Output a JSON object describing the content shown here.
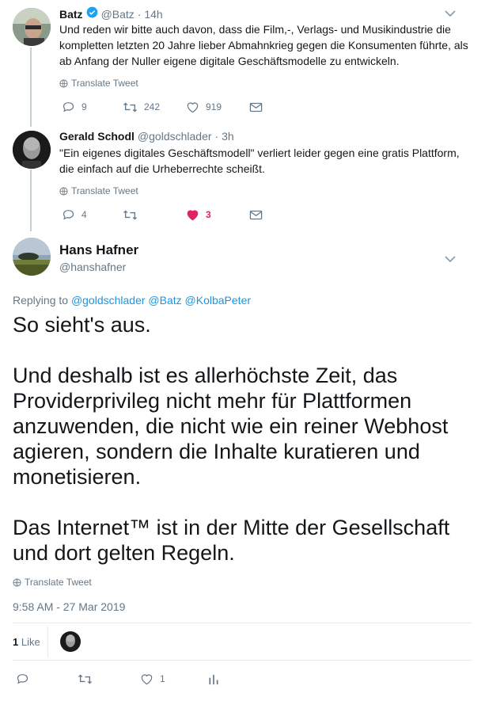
{
  "tweet1": {
    "name": "Batz",
    "handle": "@Batz",
    "time": "· 14h",
    "text": "Und reden wir bitte auch davon, dass die Film,-, Verlags- und Musikindustrie die kompletten letzten 20 Jahre lieber Abmahnkrieg gegen die Konsumenten führte, als ab Anfang der Nuller eigene digitale Geschäftsmodelle zu entwickeln.",
    "translate": "Translate Tweet",
    "replies": "9",
    "retweets": "242",
    "likes": "919"
  },
  "tweet2": {
    "name": "Gerald Schodl",
    "handle": "@goldschlader",
    "time": "· 3h",
    "text": "\"Ein eigenes digitales Geschäftsmodell\" verliert leider gegen eine gratis Plattform, die einfach auf die Urheberrechte scheißt.",
    "translate": "Translate Tweet",
    "replies": "4",
    "retweets": "",
    "likes": "3"
  },
  "main_tweet": {
    "name": "Hans Hafner",
    "handle": "@hanshafner",
    "replying_prefix": "Replying to",
    "replying_to": "@goldschlader @Batz @KolbaPeter",
    "paragraphs": [
      "So sieht's aus.",
      "Und deshalb ist es allerhöchste Zeit, das Providerprivileg nicht mehr für Plattformen anzuwenden, die nicht wie ein reiner Webhost agieren, sondern die Inhalte kuratieren und monetisieren.",
      "Das Internet™ ist in der Mitte der Gesellschaft und dort gelten Regeln."
    ],
    "translate": "Translate Tweet",
    "timestamp": "9:58 AM - 27 Mar 2019",
    "like_count": "1",
    "like_label": "Like",
    "action_likes": "1"
  },
  "colors": {
    "verified": "#1da1f2",
    "liked": "#e0245e",
    "link": "#1b95e0",
    "muted": "#657786"
  },
  "icons": [
    "verified-badge-icon",
    "chevron-down-icon",
    "globe-icon",
    "reply-icon",
    "retweet-icon",
    "heart-icon",
    "mail-icon",
    "analytics-icon"
  ]
}
